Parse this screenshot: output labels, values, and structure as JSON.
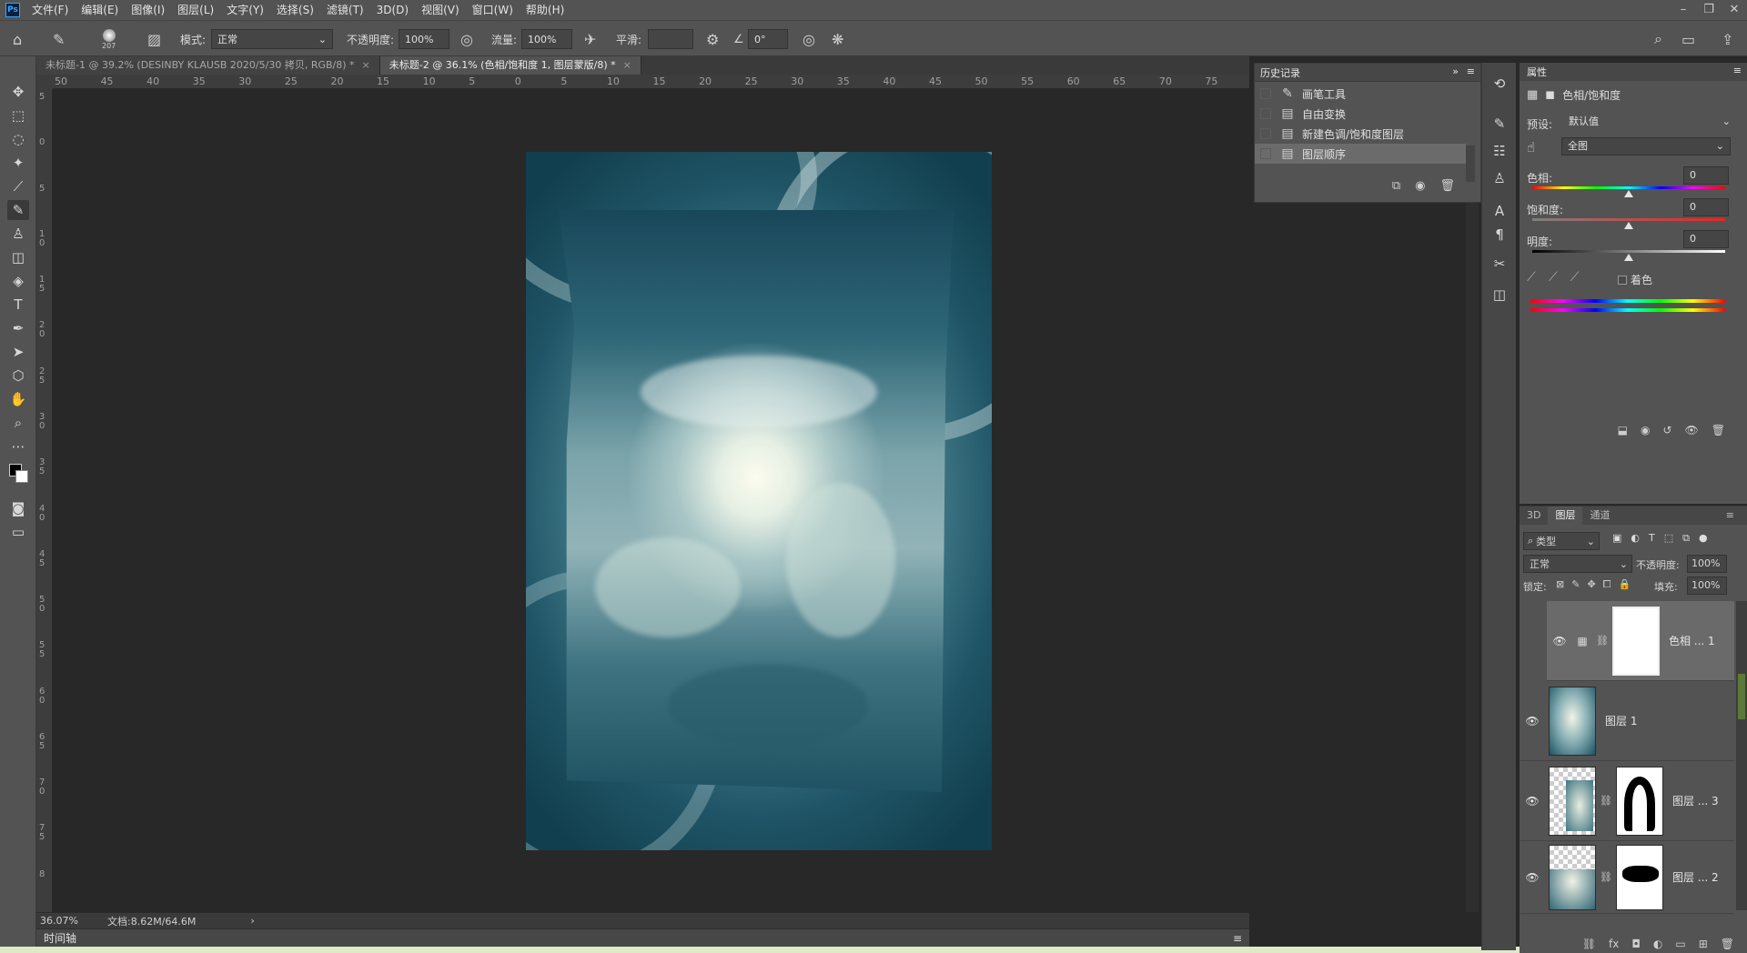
{
  "app": {
    "logo": "Ps",
    "menu": [
      "文件(F)",
      "编辑(E)",
      "图像(I)",
      "图层(L)",
      "文字(Y)",
      "选择(S)",
      "滤镜(T)",
      "3D(D)",
      "视图(V)",
      "窗口(W)",
      "帮助(H)"
    ]
  },
  "options_bar": {
    "brush_size": "207",
    "mode_label": "模式:",
    "mode_value": "正常",
    "opacity_label": "不透明度:",
    "opacity_value": "100%",
    "flow_label": "流量:",
    "flow_value": "100%",
    "smooth_label": "平滑:",
    "angle_value": "0°"
  },
  "doc_tabs": [
    {
      "title": "未标题-1 @ 39.2% (DESINBY KLAUSB    2020/5/30 拷贝, RGB/8) *",
      "active": false
    },
    {
      "title": "未标题-2 @ 36.1% (色相/饱和度 1, 图层蒙版/8) *",
      "active": true
    }
  ],
  "rulers": {
    "horizontal": [
      "50",
      "45",
      "40",
      "35",
      "30",
      "25",
      "20",
      "15",
      "10",
      "5",
      "0",
      "5",
      "10",
      "15",
      "20",
      "25",
      "30",
      "35",
      "40",
      "45",
      "50",
      "55",
      "60",
      "65",
      "70",
      "75"
    ],
    "vertical": [
      "5",
      "0",
      "5",
      "10",
      "15",
      "20",
      "25",
      "30",
      "35",
      "40",
      "45",
      "50",
      "55",
      "60",
      "65",
      "70",
      "75",
      "8"
    ]
  },
  "status": {
    "zoom": "36.07%",
    "doc_info": "文档:8.62M/64.6M",
    "timeline": "时间轴"
  },
  "history": {
    "title": "历史记录",
    "items": [
      {
        "label": "画笔工具",
        "icon": "brush-icon",
        "selected": false
      },
      {
        "label": "自由变换",
        "icon": "document-icon",
        "selected": false
      },
      {
        "label": "新建色调/饱和度图层",
        "icon": "document-icon",
        "selected": false
      },
      {
        "label": "图层顺序",
        "icon": "document-icon",
        "selected": true
      }
    ]
  },
  "properties": {
    "title": "属性",
    "adjustment_name": "色相/饱和度",
    "preset_label": "预设:",
    "preset_value": "默认值",
    "channel_value": "全图",
    "hue_label": "色相:",
    "hue_value": "0",
    "saturation_label": "饱和度:",
    "saturation_value": "0",
    "lightness_label": "明度:",
    "lightness_value": "0",
    "colorize_label": "着色"
  },
  "layers": {
    "tabs": [
      "3D",
      "图层",
      "通道"
    ],
    "active_tab": "图层",
    "filter_label": "类型",
    "blend_mode": "正常",
    "opacity_label": "不透明度:",
    "opacity_value": "100%",
    "lock_label": "锁定:",
    "fill_label": "填充:",
    "fill_value": "100%",
    "rows": [
      {
        "name": "色相 ... 1",
        "selected": true
      },
      {
        "name": "图层 1",
        "selected": false
      },
      {
        "name": "图层 ... 3",
        "selected": false
      },
      {
        "name": "图层 ... 2",
        "selected": false
      }
    ]
  },
  "colors": {
    "ui_panel": "#535353",
    "ui_dark": "#282828",
    "accent_blue": "#31a8ff"
  }
}
